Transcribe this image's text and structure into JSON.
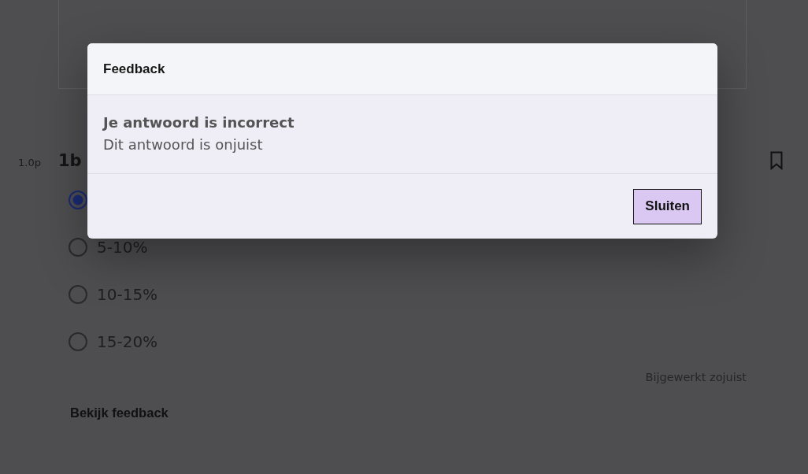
{
  "question": {
    "points": "1.0p",
    "number": "1b",
    "bookmarked": false,
    "options": [
      {
        "selected": true
      },
      {
        "label": "5-10%",
        "selected": false
      },
      {
        "label": "10-15%",
        "selected": false
      },
      {
        "label": "15-20%",
        "selected": false
      }
    ]
  },
  "updated_status": "Bijgewerkt zojuist",
  "feedback_link": "Bekijk feedback",
  "feedback_dialog": {
    "title": "Feedback",
    "heading": "Je antwoord is incorrect",
    "message": "Dit antwoord is onjuist",
    "buttons": [
      {
        "label": "Sluiten"
      }
    ]
  }
}
